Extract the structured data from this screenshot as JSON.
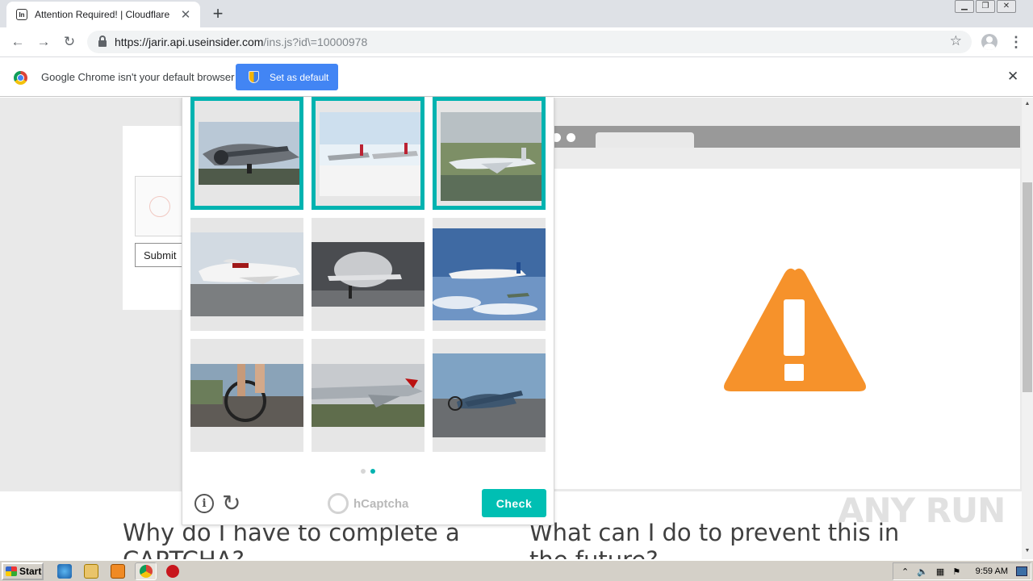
{
  "browser": {
    "tab_title": "Attention Required! | Cloudflare",
    "favicon_text": "In",
    "url_host": "https://jarir.api.useinsider.com",
    "url_path": "/ins.js?id\\=10000978"
  },
  "infobar": {
    "message": "Google Chrome isn't your default browser",
    "set_default_label": "Set as default"
  },
  "cloudflare": {
    "submit_label": "Submit",
    "faq_left": "Why do I have to complete a CAPTCHA?",
    "faq_right": "What can I do to prevent this in the future?"
  },
  "captcha": {
    "brand": "hCaptcha",
    "check_label": "Check",
    "page_count": 2,
    "current_page": 2,
    "tiles": [
      {
        "subject": "vintage-trimotor-airplane",
        "selected": true
      },
      {
        "subject": "prop-airliners-on-runway",
        "selected": true
      },
      {
        "subject": "jet-airliner-at-airport",
        "selected": true
      },
      {
        "subject": "boeing-747-on-tarmac",
        "selected": false
      },
      {
        "subject": "airplane-nose-in-hangar",
        "selected": false
      },
      {
        "subject": "airliner-in-flight-over-clouds",
        "selected": false
      },
      {
        "subject": "bicycle-wheels-street",
        "selected": false
      },
      {
        "subject": "fighter-jet-on-grass",
        "selected": false
      },
      {
        "subject": "warbird-on-runway",
        "selected": false
      }
    ]
  },
  "taskbar": {
    "start_label": "Start",
    "clock": "9:59 AM"
  },
  "watermark": "ANY RUN",
  "colors": {
    "captcha_accent": "#00b3b0",
    "warning_orange": "#f6922b",
    "chrome_blue": "#4285f4"
  }
}
